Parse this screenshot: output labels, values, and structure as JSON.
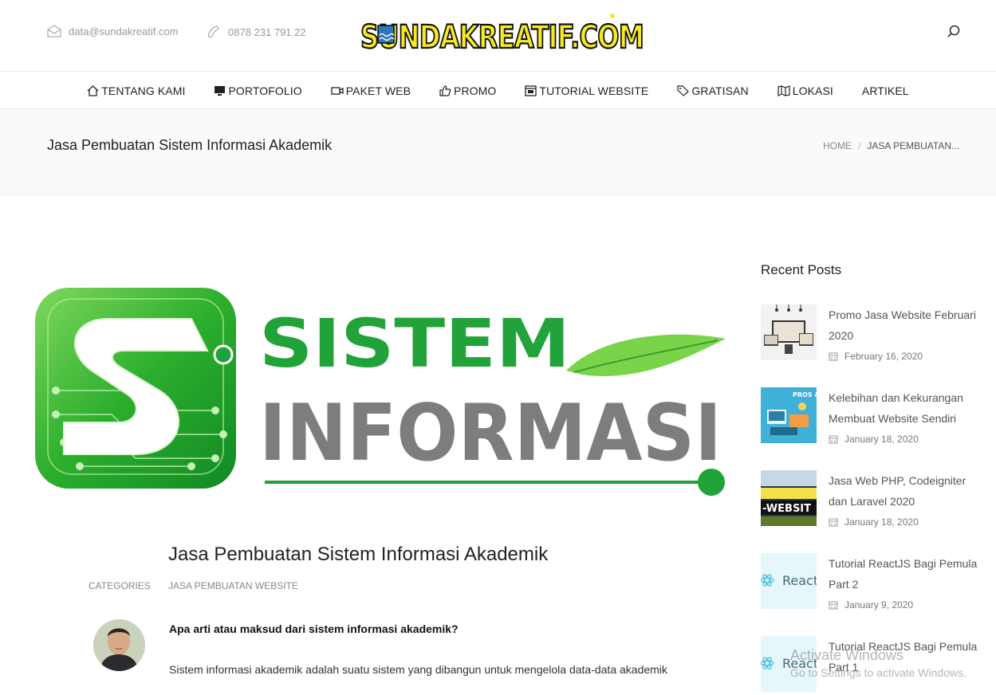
{
  "header": {
    "email": "data@sundakreatif.com",
    "phone": "0878 231 791 22",
    "logo_text": "SUNDAKREATIF.COM"
  },
  "nav": {
    "items": [
      {
        "label": "TENTANG KAMI",
        "icon": "home-icon"
      },
      {
        "label": "PORTOFOLIO",
        "icon": "monitor-icon"
      },
      {
        "label": "PAKET WEB",
        "icon": "video-icon"
      },
      {
        "label": "PROMO",
        "icon": "thumbs-up-icon"
      },
      {
        "label": "TUTORIAL WEBSITE",
        "icon": "browser-icon"
      },
      {
        "label": "GRATISAN",
        "icon": "tag-icon"
      },
      {
        "label": "LOKASI",
        "icon": "map-icon"
      },
      {
        "label": "ARTIKEL",
        "icon": ""
      }
    ]
  },
  "titlebar": {
    "title": "Jasa Pembuatan Sistem Informasi Akademik",
    "breadcrumb_home": "HOME",
    "breadcrumb_sep": "/",
    "breadcrumb_current": "JASA PEMBUATAN..."
  },
  "feature_image": {
    "word1": "SISTEM",
    "word2": "INFORMASI"
  },
  "post": {
    "title": "Jasa Pembuatan Sistem Informasi Akademik",
    "categories_label": "CATEGORIES",
    "category": "JASA PEMBUATAN WEBSITE",
    "question": "Apa arti atau maksud dari sistem informasi akademik?",
    "paragraph": "Sistem informasi akademik adalah suatu sistem yang dibangun untuk mengelola data-data akademik"
  },
  "sidebar": {
    "title": "Recent Posts",
    "posts": [
      {
        "title": "Promo Jasa Website Februari 2020",
        "date": "February 16, 2020"
      },
      {
        "title": "Kelebihan dan Kekurangan Membuat Website Sendiri",
        "date": "January 18, 2020"
      },
      {
        "title": "Jasa Web PHP, Codeigniter dan Laravel 2020",
        "date": "January 18, 2020"
      },
      {
        "title": "Tutorial ReactJS Bagi Pemula Part 2",
        "date": "January 9, 2020"
      },
      {
        "title": "Tutorial ReactJS Bagi Pemula Part 1",
        "date": ""
      }
    ],
    "thumb_text_react": "React.",
    "thumb_text_pros": "PROS &"
  },
  "watermark": {
    "line1": "Activate Windows",
    "line2": "Go to Settings to activate Windows."
  },
  "colors": {
    "green": "#21a33a",
    "grey_text": "#7d7d7d",
    "logo_yellow": "#f6ea22"
  }
}
